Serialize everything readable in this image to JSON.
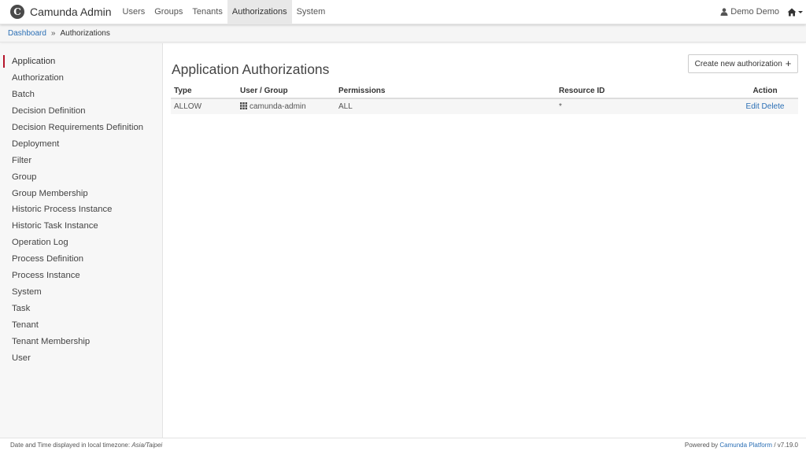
{
  "app": {
    "title": "Camunda Admin",
    "logo_letter": "C"
  },
  "nav": {
    "items": [
      {
        "label": "Users"
      },
      {
        "label": "Groups"
      },
      {
        "label": "Tenants"
      },
      {
        "label": "Authorizations",
        "active": true
      },
      {
        "label": "System"
      }
    ],
    "user_label": "Demo Demo",
    "user_icon": "user-icon",
    "home_icon": "home-icon"
  },
  "breadcrumb": {
    "dashboard": "Dashboard",
    "separator": "»",
    "current": "Authorizations"
  },
  "sidebar": {
    "items": [
      {
        "label": "Application",
        "active": true
      },
      {
        "label": "Authorization"
      },
      {
        "label": "Batch"
      },
      {
        "label": "Decision Definition"
      },
      {
        "label": "Decision Requirements Definition"
      },
      {
        "label": "Deployment"
      },
      {
        "label": "Filter"
      },
      {
        "label": "Group"
      },
      {
        "label": "Group Membership"
      },
      {
        "label": "Historic Process Instance"
      },
      {
        "label": "Historic Task Instance"
      },
      {
        "label": "Operation Log"
      },
      {
        "label": "Process Definition"
      },
      {
        "label": "Process Instance"
      },
      {
        "label": "System"
      },
      {
        "label": "Task"
      },
      {
        "label": "Tenant"
      },
      {
        "label": "Tenant Membership"
      },
      {
        "label": "User"
      }
    ]
  },
  "main": {
    "title": "Application Authorizations",
    "create_button": "Create new authorization",
    "create_icon": "+",
    "table": {
      "headers": {
        "type": "Type",
        "user_group": "User / Group",
        "permissions": "Permissions",
        "resource_id": "Resource ID",
        "action": "Action"
      },
      "rows": [
        {
          "type": "ALLOW",
          "user_group": "camunda-admin",
          "user_group_icon": "group-grid-icon",
          "permissions": "ALL",
          "resource_id": "*",
          "edit": "Edit",
          "delete": "Delete"
        }
      ]
    }
  },
  "footer": {
    "timezone_prefix": "Date and Time displayed in local timezone:",
    "timezone": "Asia/Taipei",
    "powered_by": "Powered by",
    "platform_link": "Camunda Platform",
    "version": "/ v7.19.0"
  },
  "colors": {
    "accent": "#b5152b",
    "link": "#2b6fb5"
  }
}
